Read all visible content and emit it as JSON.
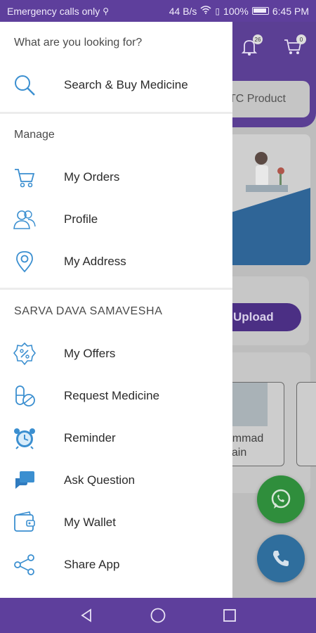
{
  "status_bar": {
    "left_text": "Emergency calls only",
    "speed": "44 B/s",
    "battery": "100%",
    "time": "6:45 PM"
  },
  "background_app": {
    "notification_badge": "26",
    "cart_badge": "0",
    "otc_label": "TC Product",
    "upload_label": "Upload",
    "doctor_name": "hammad\nusain"
  },
  "drawer": {
    "heading": "What are you looking for?",
    "search_item": {
      "label": "Search & Buy Medicine",
      "icon": "search-icon"
    },
    "manage_title": "Manage",
    "manage_items": [
      {
        "label": "My Orders",
        "icon": "cart-icon"
      },
      {
        "label": "Profile",
        "icon": "profile-icon"
      },
      {
        "label": "My Address",
        "icon": "location-pin-icon"
      }
    ],
    "brand_title": "SARVA DAVA SAMAVESHA",
    "brand_items": [
      {
        "label": "My Offers",
        "icon": "percent-badge-icon"
      },
      {
        "label": "Request Medicine",
        "icon": "pills-icon"
      },
      {
        "label": "Reminder",
        "icon": "alarm-clock-icon"
      },
      {
        "label": "Ask Question",
        "icon": "chat-bubbles-icon"
      },
      {
        "label": "My Wallet",
        "icon": "wallet-icon"
      },
      {
        "label": "Share App",
        "icon": "share-icon"
      }
    ]
  },
  "colors": {
    "accent": "#3b8fd0",
    "status_bar": "#5e3f9c",
    "header": "#5b3f94"
  }
}
